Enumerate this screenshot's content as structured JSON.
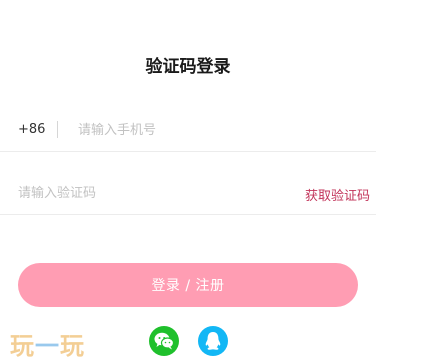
{
  "title": "验证码登录",
  "phone": {
    "prefix": "+86",
    "placeholder": "请输入手机号",
    "value": ""
  },
  "code": {
    "placeholder": "请输入验证码",
    "value": "",
    "get_code_label": "获取验证码"
  },
  "login_button_label": "登录 / 注册",
  "watermark": {
    "text": "玩一玩"
  },
  "social": [
    {
      "icon": "wechat-icon",
      "color": "#1fc02c"
    },
    {
      "icon": "qq-icon",
      "color": "#12b7f5"
    }
  ],
  "colors": {
    "accent": "#c2345a",
    "button": "#ff9db3"
  }
}
